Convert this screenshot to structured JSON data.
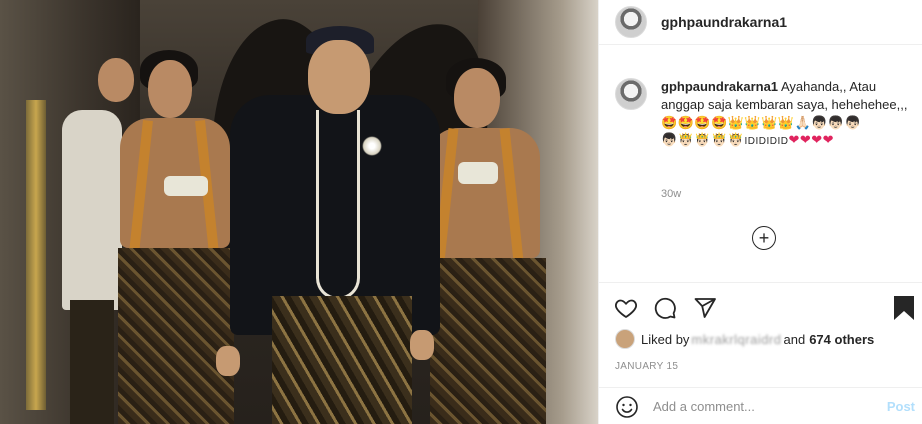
{
  "post": {
    "username": "gphpaundrakarna1",
    "caption": {
      "username": "gphpaundrakarna1",
      "text": "Ayahanda,, Atau anggap saja kembaran saya, hehehehee,,,",
      "emoji_line_1": "🤩🤩🤩🤩👑👑👑👑🙏🏻👦🏻👦🏻👦🏻",
      "emoji_line_2": "👦🏻🤴🏻🤴🏻🤴🏻🤴🏻",
      "emoji_text": "IDIDIDID",
      "emoji_hearts": "❤❤❤❤"
    },
    "time_ago": "30w",
    "load_more_icon": "+",
    "likes": {
      "prefix": "Liked by",
      "blurred_user": "mkrakrlqraidrd",
      "connector": "and",
      "others": "674 others"
    },
    "date": "JANUARY 15",
    "comment": {
      "placeholder": "Add a comment...",
      "post_label": "Post"
    }
  },
  "icons": [
    "heart-icon",
    "comment-icon",
    "share-icon",
    "bookmark-icon",
    "emoji-icon",
    "plus-circle-icon"
  ],
  "colors": {
    "text": "#262626",
    "muted": "#8e8e8e",
    "border": "#efefef",
    "post_button_disabled": "#b2dffc"
  }
}
